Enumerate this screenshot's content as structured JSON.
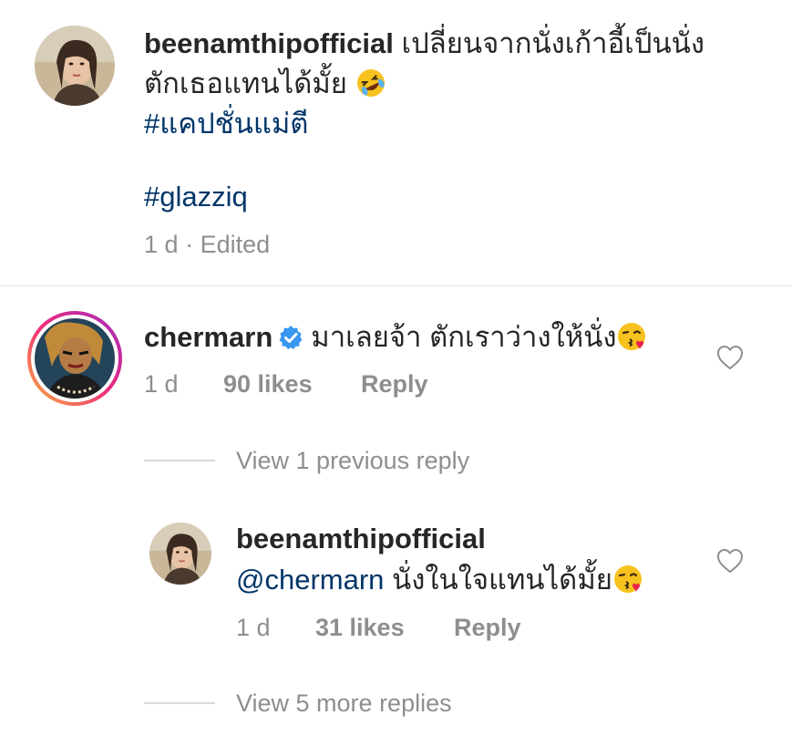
{
  "comment1": {
    "username": "beenamthipofficial",
    "text_line1": "เปลี่ยนจากนั่งเก้าอี้เป็นนั่ง",
    "text_line2": "ตักเธอแทนได้มั้ย",
    "emoji": "rolling-on-floor-laughing-emoji",
    "hashtag1": "#แคปชั่นแม่ตี",
    "hashtag2": "#glazziq",
    "time": "1 d",
    "separator": "·",
    "edited": "Edited"
  },
  "comment2": {
    "username": "chermarn",
    "verified": true,
    "text": "มาเลยจ้า ตักเราว่างให้นั่ง",
    "emoji": "face-blowing-kiss-emoji",
    "time": "1 d",
    "likes": "90 likes",
    "reply_label": "Reply",
    "view_previous": "View 1 previous reply"
  },
  "reply1": {
    "username": "beenamthipofficial",
    "mention": "@chermarn",
    "text": "นั่งในใจแทนได้มั้ย",
    "emoji": "face-blowing-kiss-emoji",
    "time": "1 d",
    "likes": "31 likes",
    "reply_label": "Reply",
    "view_more": "View 5 more replies"
  },
  "colors": {
    "text": "#262626",
    "secondary": "#8e8e8e",
    "hashtag": "#003569",
    "verified": "#3897f0",
    "divider": "#e6e6e6"
  }
}
